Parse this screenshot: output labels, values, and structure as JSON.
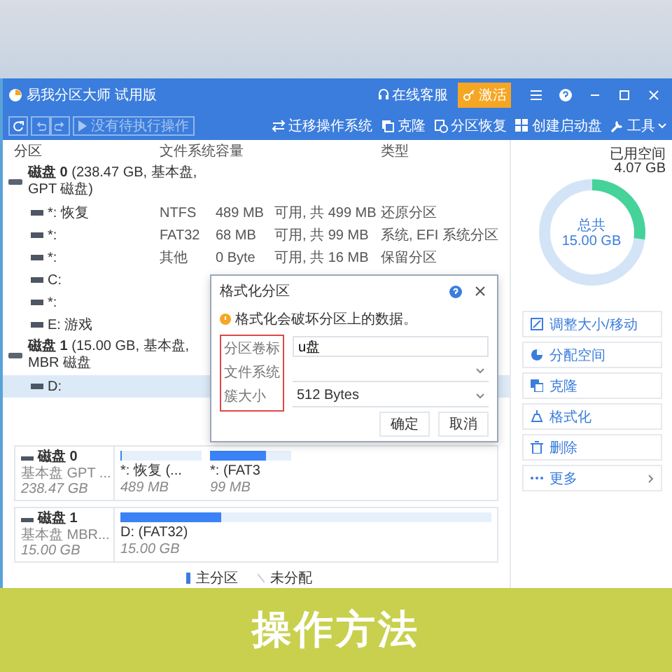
{
  "window": {
    "title": "易我分区大师 试用版",
    "service": "在线客服",
    "activate": "激活"
  },
  "toolbar": {
    "pending": "没有待执行操作",
    "actions": [
      {
        "label": "迁移操作系统"
      },
      {
        "label": "克隆"
      },
      {
        "label": "分区恢复"
      },
      {
        "label": "创建启动盘"
      },
      {
        "label": "工具"
      }
    ]
  },
  "table": {
    "header": {
      "partition": "分区",
      "filesystem": "文件系统",
      "capacity": "容量",
      "type": "类型"
    },
    "rows": [
      {
        "kind": "disk",
        "text": "**磁盘 0** (238.47 GB, 基本盘, GPT 磁盘)",
        "selected": false
      },
      {
        "kind": "partition",
        "name": "*: 恢复",
        "filesystem": "NTFS",
        "used": "489 MB",
        "free": "可用, 共 499 MB",
        "type": "还原分区",
        "selected": false
      },
      {
        "kind": "partition",
        "name": "*:",
        "filesystem": "FAT32",
        "used": "68 MB",
        "free": "可用, 共 99 MB",
        "type": "系统, EFI 系统分区",
        "selected": false
      },
      {
        "kind": "partition",
        "name": "*:",
        "filesystem": "其他",
        "used": "0 Byte",
        "free": "可用, 共 16 MB",
        "type": "保留分区",
        "selected": false
      },
      {
        "kind": "partition",
        "name": "C:",
        "selected": false
      },
      {
        "kind": "partition",
        "name": "*:",
        "selected": false
      },
      {
        "kind": "partition",
        "name": "E: 游戏",
        "selected": false
      },
      {
        "kind": "disk",
        "text": "**磁盘 1** (15.00 GB, 基本盘, MBR 磁盘",
        "selected": false
      },
      {
        "kind": "partition",
        "name": "D:",
        "selected": true
      }
    ]
  },
  "dialog": {
    "title": "格式化分区",
    "warning": "格式化会破坏分区上的数据。",
    "fields": [
      {
        "kind": "text",
        "label": "分区卷标",
        "value": "u盘"
      },
      {
        "kind": "select",
        "label": "文件系统"
      },
      {
        "kind": "select",
        "label": "簇大小",
        "value": "512 Bytes"
      }
    ],
    "buttons": [
      "确定",
      "取消"
    ]
  },
  "usage": {
    "used_label": "已用空间",
    "used": "4.07 GB",
    "total_label": "总共",
    "total": "15.00 GB"
  },
  "actions": [
    {
      "kind": "action",
      "label": "调整大小/移动"
    },
    {
      "kind": "action",
      "label": "分配空间"
    },
    {
      "kind": "action",
      "label": "克隆"
    },
    {
      "kind": "action",
      "label": "格式化"
    },
    {
      "kind": "action",
      "label": "删除"
    },
    {
      "kind": "submenu",
      "label": "更多"
    }
  ],
  "disks": [
    {
      "name": "磁盘 0",
      "type": "基本盘 GPT ...",
      "size": "238.47 GB",
      "partitions": [
        {
          "label": "*: 恢复 (...",
          "size": "489 MB",
          "level": 0.02
        },
        {
          "label": "*: (FAT3",
          "size": "99 MB",
          "level": 0.69
        }
      ]
    },
    {
      "name": "磁盘 1",
      "type": "基本盘 MBR...",
      "size": "15.00 GB",
      "partitions": [
        {
          "label": "D: (FAT32)",
          "size": "15.00 GB",
          "level": 0.27
        }
      ]
    }
  ],
  "legend": [
    {
      "kind": "primary",
      "label": "主分区"
    },
    {
      "kind": "unallocated",
      "label": "未分配"
    }
  ],
  "banner": {
    "text": "操作方法"
  }
}
